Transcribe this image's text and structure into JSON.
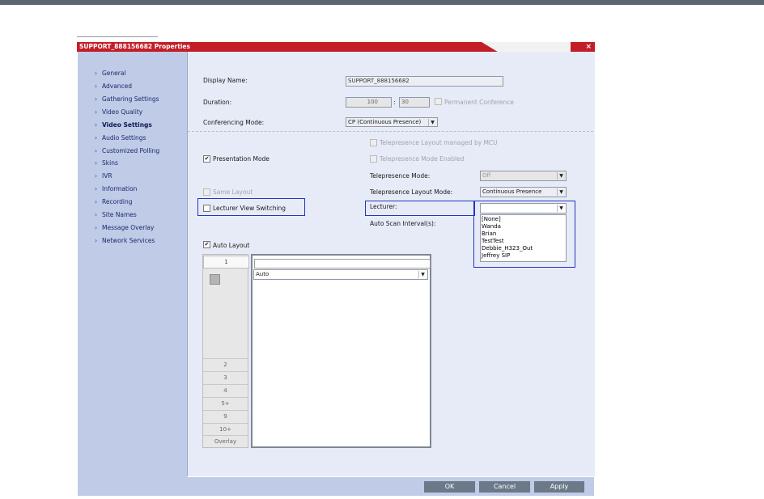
{
  "window": {
    "title": "SUPPORT_888156682 Properties",
    "close": "×"
  },
  "nav": [
    {
      "label": "General"
    },
    {
      "label": "Advanced"
    },
    {
      "label": "Gathering Settings"
    },
    {
      "label": "Video Quality"
    },
    {
      "label": "Video Settings",
      "active": true
    },
    {
      "label": "Audio Settings"
    },
    {
      "label": "Customized Polling"
    },
    {
      "label": "Skins"
    },
    {
      "label": "IVR"
    },
    {
      "label": "Information"
    },
    {
      "label": "Recording"
    },
    {
      "label": "Site Names"
    },
    {
      "label": "Message Overlay"
    },
    {
      "label": "Network Services"
    }
  ],
  "form": {
    "display_name_label": "Display Name:",
    "display_name_value": "SUPPORT_888156682",
    "duration_label": "Duration:",
    "duration_hours": "100",
    "duration_sep": ":",
    "duration_minutes": "30",
    "permanent_label": "Permanent Conference",
    "conf_mode_label": "Conferencing Mode:",
    "conf_mode_value": "CP (Continuous Presence)",
    "tp_layout_mcu_label": "Telepresence Layout managed by MCU",
    "presentation_mode_label": "Presentation Mode",
    "presentation_mode_checked": "✔",
    "tp_mode_enabled_label": "Telepresence Mode Enabled",
    "tp_mode_label": "Telepresence Mode:",
    "tp_mode_value": "Off",
    "same_layout_label": "Same Layout",
    "tp_layout_mode_label": "Telepresence Layout Mode:",
    "tp_layout_mode_value": "Continuous Presence",
    "lecturer_view_label": "Lecturer View Switching",
    "lecturer_label": "Lecturer:",
    "lecturer_value": "",
    "auto_scan_label": "Auto Scan Interval(s):",
    "lecturer_options": [
      "[None]",
      "Wanda",
      "Brian",
      "TestTest",
      "Debbie_H323_Out",
      "Jeffrey SIP"
    ],
    "auto_layout_label": "Auto Layout",
    "auto_layout_checked": "✔"
  },
  "layout_panel": {
    "tabs": [
      "1",
      "2",
      "3",
      "4",
      "5+",
      "9",
      "10+",
      "Overlay"
    ],
    "layout_select_value": "Auto"
  },
  "footer": {
    "ok": "OK",
    "cancel": "Cancel",
    "apply": "Apply"
  },
  "colors": {
    "title_bar": "#c31e28",
    "left_pane": "#bfcbe7",
    "content_bg": "#e7ebf7",
    "highlight_border": "#2434c0",
    "button": "#6c7988"
  }
}
